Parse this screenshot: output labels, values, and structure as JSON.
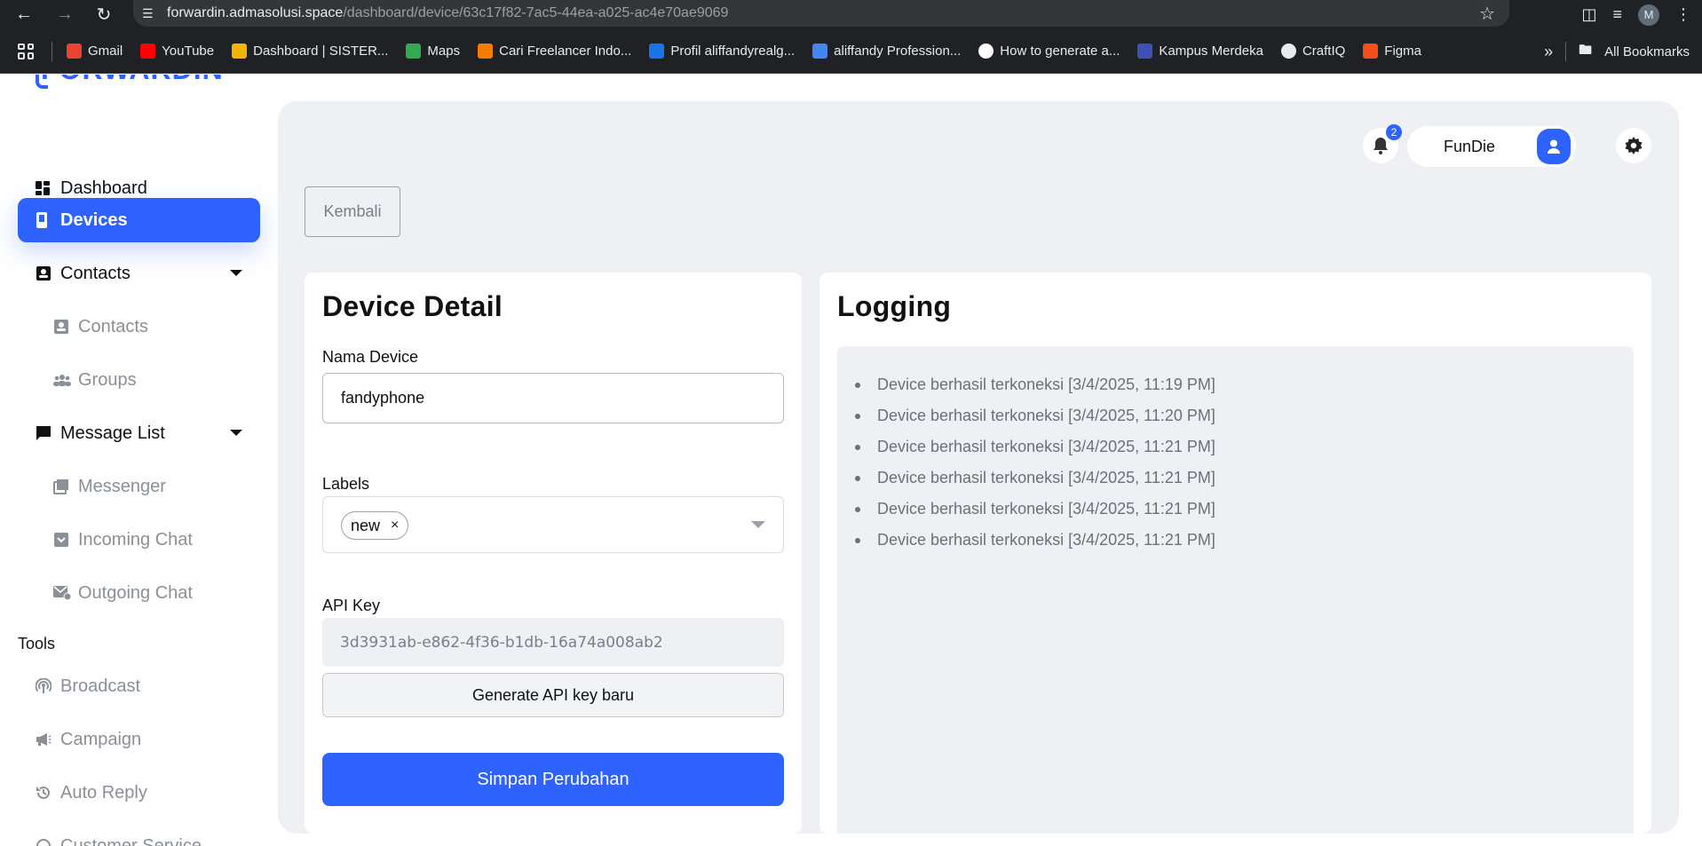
{
  "browser": {
    "url_host": "forwardin.admasolusi.space",
    "url_path": "/dashboard/device/63c17f82-7ac5-44ea-a025-ac4e70ae9069",
    "profile_initial": "M",
    "bookmarks": [
      {
        "label": "Gmail",
        "icon": "gmail-icon",
        "color": "#ea4335"
      },
      {
        "label": "YouTube",
        "icon": "youtube-icon",
        "color": "#ff0000"
      },
      {
        "label": "Dashboard | SISTER...",
        "icon": "sister-icon",
        "color": "#f4b400"
      },
      {
        "label": "Maps",
        "icon": "maps-icon",
        "color": "#34a853"
      },
      {
        "label": "Cari Freelancer Indo...",
        "icon": "freelancer-icon",
        "color": "#f57c00"
      },
      {
        "label": "Profil aliffandyrealg...",
        "icon": "profile-s-icon",
        "color": "#1a73e8"
      },
      {
        "label": "aliffandy Profession...",
        "icon": "triangle-icon",
        "color": "#4285f4"
      },
      {
        "label": "How to generate a...",
        "icon": "github-icon",
        "color": "#ffffff"
      },
      {
        "label": "Kampus Merdeka",
        "icon": "kampus-icon",
        "color": "#3f51b5"
      },
      {
        "label": "CraftIQ",
        "icon": "globe-icon",
        "color": "#e8eaed"
      },
      {
        "label": "Figma",
        "icon": "figma-icon",
        "color": "#f24e1e"
      }
    ],
    "more_label": "»",
    "all_bookmarks_label": "All Bookmarks"
  },
  "sidebar": {
    "logo_text": "FORWARDIN",
    "items": [
      {
        "label": "Dashboard",
        "icon": "dashboard-icon"
      },
      {
        "label": "Devices",
        "icon": "phone-icon"
      },
      {
        "label": "Contacts",
        "icon": "contacts-icon"
      },
      {
        "label": "Contacts",
        "icon": "contact-card-icon"
      },
      {
        "label": "Groups",
        "icon": "groups-icon"
      },
      {
        "label": "Message List",
        "icon": "message-icon"
      },
      {
        "label": "Messenger",
        "icon": "messenger-icon"
      },
      {
        "label": "Incoming Chat",
        "icon": "inbox-icon"
      },
      {
        "label": "Outgoing Chat",
        "icon": "outgoing-mail-icon"
      }
    ],
    "tools_label": "Tools",
    "tools": [
      {
        "label": "Broadcast",
        "icon": "broadcast-icon"
      },
      {
        "label": "Campaign",
        "icon": "megaphone-icon"
      },
      {
        "label": "Auto Reply",
        "icon": "auto-reply-icon"
      },
      {
        "label": "Customer Service",
        "icon": "headset-icon"
      }
    ]
  },
  "header": {
    "notification_count": "2",
    "username": "FunDie"
  },
  "back_button": "Kembali",
  "device_detail": {
    "title": "Device Detail",
    "name_label": "Nama Device",
    "name_value": "fandyphone",
    "labels_label": "Labels",
    "label_chip": "new",
    "chip_remove": "×",
    "api_key_label": "API Key",
    "api_key_value": "3d3931ab-e862-4f36-b1db-16a74a008ab2",
    "generate_button": "Generate API key baru",
    "save_button": "Simpan Perubahan"
  },
  "logging": {
    "title": "Logging",
    "entries": [
      "Device berhasil terkoneksi [3/4/2025, 11:19 PM]",
      "Device berhasil terkoneksi [3/4/2025, 11:20 PM]",
      "Device berhasil terkoneksi [3/4/2025, 11:21 PM]",
      "Device berhasil terkoneksi [3/4/2025, 11:21 PM]",
      "Device berhasil terkoneksi [3/4/2025, 11:21 PM]",
      "Device berhasil terkoneksi [3/4/2025, 11:21 PM]"
    ]
  },
  "colors": {
    "accent": "#2f63ff",
    "panel_bg": "#eef0f4"
  }
}
